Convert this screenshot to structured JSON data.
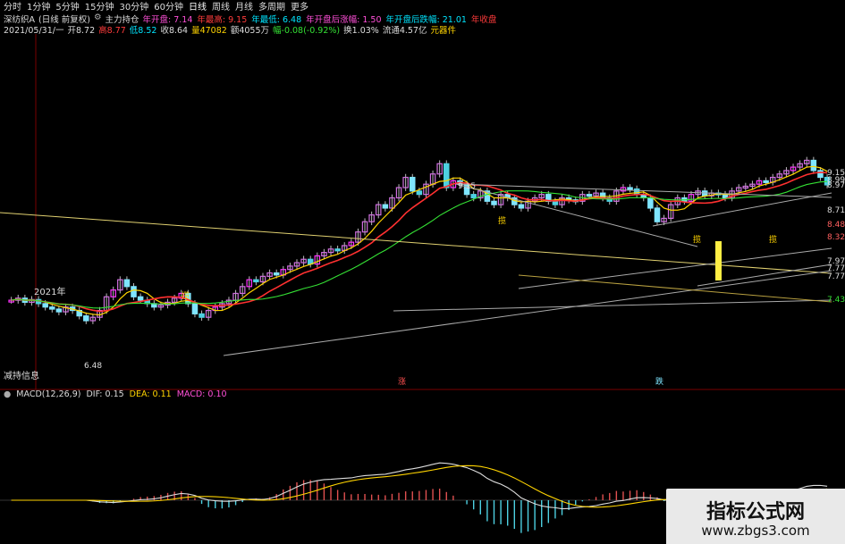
{
  "toolbar": {
    "tabs": [
      "分时",
      "1分钟",
      "5分钟",
      "15分钟",
      "30分钟",
      "60分钟",
      "日线",
      "周线",
      "月线",
      "多周期",
      "更多"
    ],
    "active": "日线"
  },
  "header": {
    "stock": "深纺织A",
    "period": "(日线 前复权)",
    "indicator": "主力持仓",
    "items": [
      {
        "label": "年开盘",
        "value": "7.14",
        "color": "#ff4fd8"
      },
      {
        "label": "年最高",
        "value": "9.15",
        "color": "#ff3b3b"
      },
      {
        "label": "年最低",
        "value": "6.48",
        "color": "#00e5ff"
      },
      {
        "label": "年开盘后涨幅",
        "value": "1.50",
        "color": "#ff4fd8"
      },
      {
        "label": "年开盘后跌幅",
        "value": "21.01",
        "color": "#00e5ff"
      },
      {
        "label": "年收盘",
        "value": "",
        "color": "#ff3b3b"
      }
    ]
  },
  "quote": {
    "date": "2021/05/31/一",
    "open": "开8.72",
    "high": "高8.77",
    "low": "低8.52",
    "close": "收8.64",
    "volume": "量47082",
    "amount": "额4055万",
    "change": "幅-0.08(-0.92%)",
    "turnover": "换1.03%",
    "circ": "流通4.57亿",
    "unit": "元器件"
  },
  "chart_labels": {
    "year": "2021年",
    "hi_price": "9.15",
    "lo_price": "6.48",
    "right_scale": [
      "9.15",
      "8.99",
      "8.97",
      "8.71",
      "8.48",
      "8.32",
      "7.97",
      "7.77",
      "7.77",
      "7.43"
    ],
    "markers": [
      "涨",
      "跌"
    ],
    "jing": "进"
  },
  "side_button": "减持信息",
  "macd": {
    "name": "MACD(12,26,9)",
    "dif": "DIF: 0.15",
    "dea": "DEA: 0.11",
    "macd": "MACD: 0.10"
  },
  "watermark": {
    "title": "指标公式网",
    "url": "www.zbgs3.com"
  }
}
